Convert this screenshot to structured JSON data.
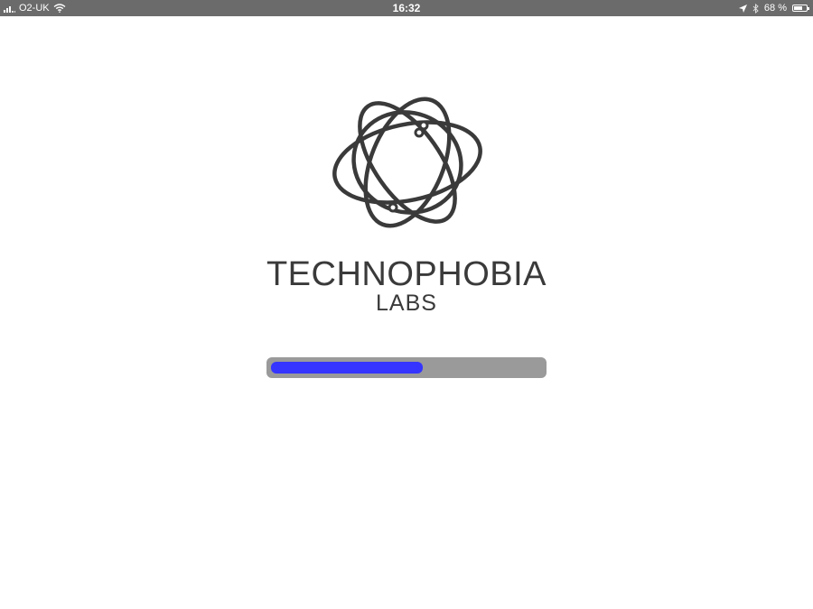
{
  "status_bar": {
    "carrier": "O2-UK",
    "time": "16:32",
    "battery_percent": "68 %",
    "battery_level": 0.68,
    "icons": [
      "signal-icon",
      "wifi-icon",
      "location-arrow-icon",
      "bluetooth-icon",
      "battery-icon"
    ]
  },
  "splash": {
    "brand_name": "TECHNOPHOBIA",
    "brand_sub": "LABS",
    "logo_icon": "atom-orbit-logo"
  },
  "loading": {
    "progress": 0.56,
    "fill_color": "#3535ff",
    "track_color": "#9a9a9a"
  }
}
